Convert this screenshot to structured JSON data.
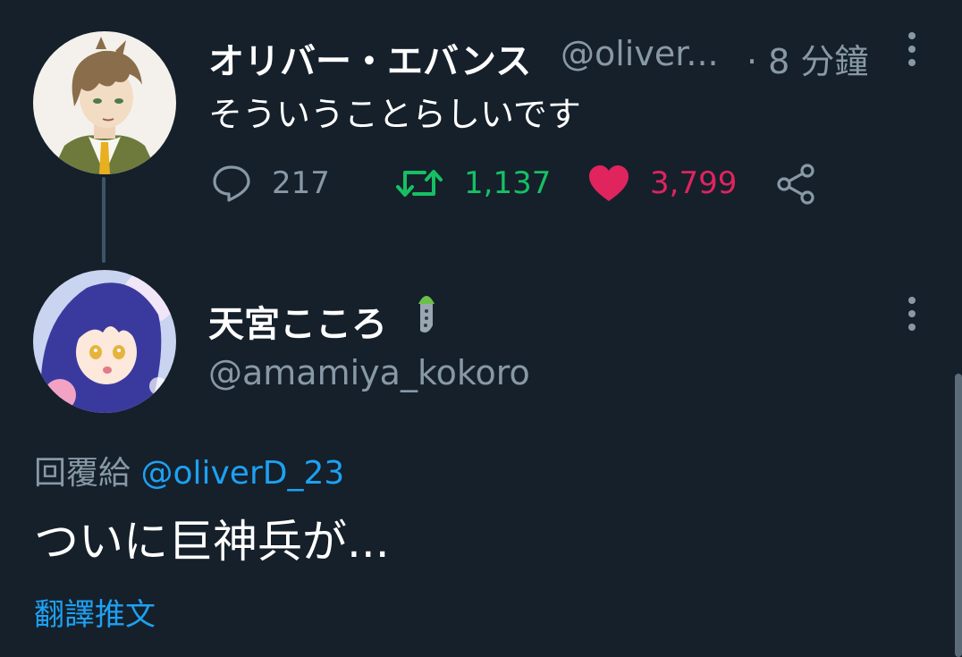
{
  "tweet1": {
    "display_name": "オリバー・エバンス",
    "handle": "@oliver...",
    "time": "· 8 分鐘",
    "text": "そういうことらしいです",
    "replies": "217",
    "retweets": "1,137",
    "likes": "3,799"
  },
  "tweet2": {
    "display_name": "天宮こころ",
    "handle": "@amamiya_kokoro",
    "reply_prefix": "回覆給",
    "reply_to": "@oliverD_23",
    "text": "ついに巨神兵が...",
    "translate_label": "翻譯推文"
  },
  "colors": {
    "background": "#15202b",
    "retweet": "#17bf63",
    "like": "#e0245e",
    "link": "#1da1f2",
    "muted": "#8899a6"
  },
  "icons": {
    "reply": "speech-bubble-icon",
    "retweet": "retweet-arrows-icon",
    "like": "heart-icon",
    "share": "share-nodes-icon",
    "more": "vertical-dots-icon"
  }
}
